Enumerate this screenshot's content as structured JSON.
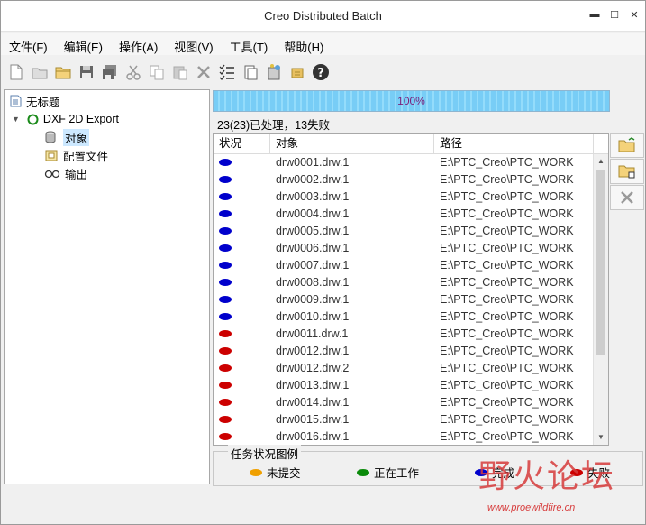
{
  "window": {
    "title": "Creo Distributed Batch"
  },
  "menu": [
    "文件(F)",
    "编辑(E)",
    "操作(A)",
    "视图(V)",
    "工具(T)",
    "帮助(H)"
  ],
  "toolbar": [
    "new-icon",
    "open-icon",
    "open-folder-icon",
    "save-icon",
    "save-all-icon",
    "cut-icon",
    "copy-icon",
    "paste-icon",
    "delete-icon",
    "checklist-icon",
    "clipboard-icon",
    "settings-icon",
    "package-icon",
    "help-icon"
  ],
  "tree": {
    "root": "无标题",
    "task": "DXF 2D Export",
    "children": [
      "对象",
      "配置文件",
      "输出"
    ]
  },
  "progress": {
    "percent": 100,
    "label": "100%"
  },
  "status_line": "23(23)已处理，13失败",
  "table": {
    "headers": [
      "状况",
      "对象",
      "路径"
    ],
    "rows": [
      {
        "status": "complete",
        "object": "drw0001.drw.1",
        "path": "E:\\PTC_Creo\\PTC_WORK"
      },
      {
        "status": "complete",
        "object": "drw0002.drw.1",
        "path": "E:\\PTC_Creo\\PTC_WORK"
      },
      {
        "status": "complete",
        "object": "drw0003.drw.1",
        "path": "E:\\PTC_Creo\\PTC_WORK"
      },
      {
        "status": "complete",
        "object": "drw0004.drw.1",
        "path": "E:\\PTC_Creo\\PTC_WORK"
      },
      {
        "status": "complete",
        "object": "drw0005.drw.1",
        "path": "E:\\PTC_Creo\\PTC_WORK"
      },
      {
        "status": "complete",
        "object": "drw0006.drw.1",
        "path": "E:\\PTC_Creo\\PTC_WORK"
      },
      {
        "status": "complete",
        "object": "drw0007.drw.1",
        "path": "E:\\PTC_Creo\\PTC_WORK"
      },
      {
        "status": "complete",
        "object": "drw0008.drw.1",
        "path": "E:\\PTC_Creo\\PTC_WORK"
      },
      {
        "status": "complete",
        "object": "drw0009.drw.1",
        "path": "E:\\PTC_Creo\\PTC_WORK"
      },
      {
        "status": "complete",
        "object": "drw0010.drw.1",
        "path": "E:\\PTC_Creo\\PTC_WORK"
      },
      {
        "status": "failed",
        "object": "drw0011.drw.1",
        "path": "E:\\PTC_Creo\\PTC_WORK"
      },
      {
        "status": "failed",
        "object": "drw0012.drw.1",
        "path": "E:\\PTC_Creo\\PTC_WORK"
      },
      {
        "status": "failed",
        "object": "drw0012.drw.2",
        "path": "E:\\PTC_Creo\\PTC_WORK"
      },
      {
        "status": "failed",
        "object": "drw0013.drw.1",
        "path": "E:\\PTC_Creo\\PTC_WORK"
      },
      {
        "status": "failed",
        "object": "drw0014.drw.1",
        "path": "E:\\PTC_Creo\\PTC_WORK"
      },
      {
        "status": "failed",
        "object": "drw0015.drw.1",
        "path": "E:\\PTC_Creo\\PTC_WORK"
      },
      {
        "status": "failed",
        "object": "drw0016.drw.1",
        "path": "E:\\PTC_Creo\\PTC_WORK"
      }
    ]
  },
  "side_buttons": [
    "open-folder-icon",
    "folder-add-icon",
    "remove-icon"
  ],
  "legend": {
    "title": "任务状况图例",
    "items": [
      {
        "label": "未提交",
        "color": "#f0a000"
      },
      {
        "label": "正在工作",
        "color": "#0a8a0a"
      },
      {
        "label": "完成",
        "color": "#0000cc"
      },
      {
        "label": "失败",
        "color": "#cc0000"
      }
    ]
  },
  "colors": {
    "complete": "#0000cc",
    "failed": "#cc0000",
    "progress": "#7ed0f7"
  },
  "watermark": {
    "big": "野火论坛",
    "small": "www.proewildfire.cn"
  }
}
